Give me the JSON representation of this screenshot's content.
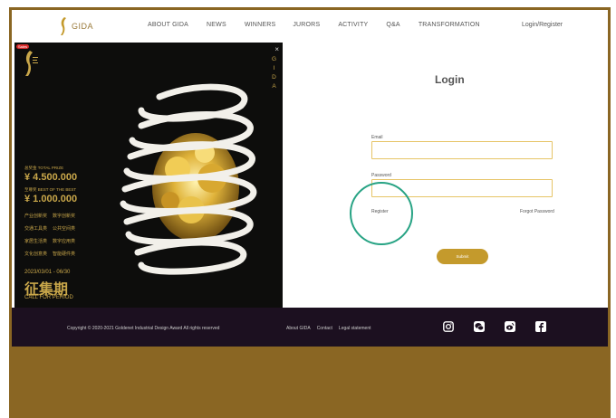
{
  "header": {
    "logo_text": "GIDA",
    "nav": [
      "ABOUT GIDA",
      "NEWS",
      "WINNERS",
      "JURORS",
      "ACTIVITY",
      "Q&A",
      "TRANSFORMATION"
    ],
    "login_register": "Login/Register"
  },
  "poster": {
    "close": "×",
    "vertical_brand": [
      "G",
      "I",
      "D",
      "A"
    ],
    "badge": "Sales",
    "total_prize_label": "总奖金  TOTAL PRIZE",
    "total_prize": "¥ 4.500.000",
    "best_label": "至尊奖  BEST OF THE BEST",
    "best_prize": "¥ 1.000.000",
    "categories": [
      "产业创新奖",
      "数字创新奖",
      "交通工具类",
      "公共空间类",
      "家居生活类",
      "数字应用类",
      "文化创意类",
      "智能硬件类"
    ],
    "dates": "2023/03/01 - 06/30",
    "period_cn": "征集期",
    "period_en": "CALL FOR PERIOD"
  },
  "login": {
    "title": "Login",
    "email_label": "Email",
    "password_label": "Password",
    "email_value": "",
    "password_value": "",
    "register_link": "Register",
    "forgot_link": "Forgot Password",
    "submit_label": "Submit"
  },
  "footer": {
    "copyright": "Copyright © 2020-2021 Goldenet Industrial Design Award All rights reserved",
    "links": [
      "About GIDA",
      "Contact",
      "Legal statement"
    ],
    "social_icons": [
      "instagram-icon",
      "wechat-icon",
      "weibo-icon",
      "facebook-icon"
    ]
  },
  "colors": {
    "gold": "#c49a2c",
    "frame_brown": "#8a6623",
    "footer_bg": "#1c1020",
    "annotation_circle": "#27a384"
  }
}
